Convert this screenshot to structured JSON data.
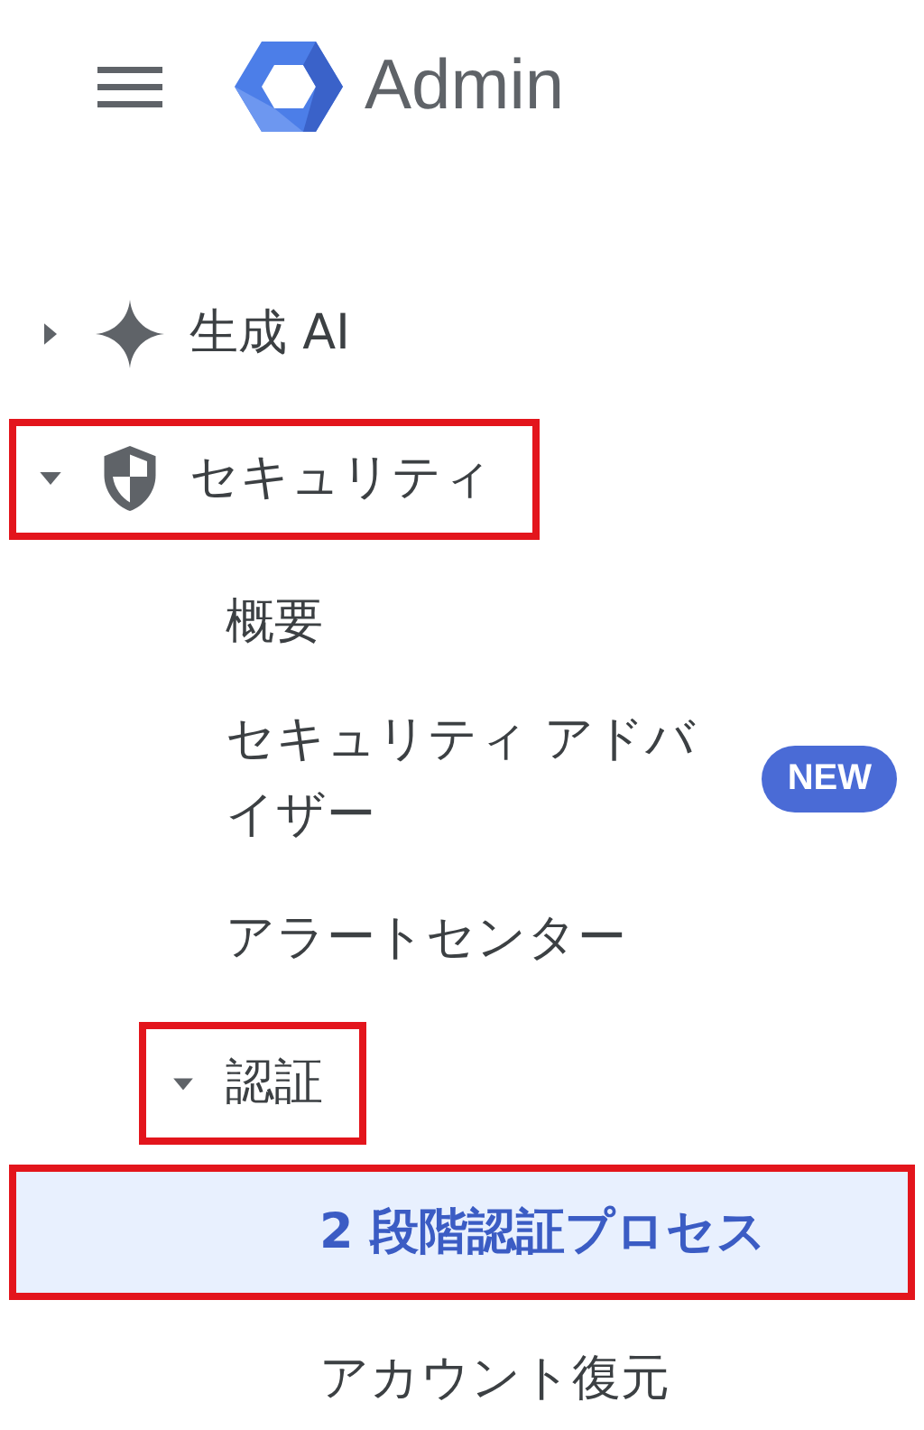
{
  "header": {
    "title": "Admin"
  },
  "nav": [
    {
      "label": "生成 AI",
      "kind": "sparkle",
      "expanded": false,
      "annotated": false
    },
    {
      "label": "セキュリティ",
      "kind": "shield",
      "expanded": true,
      "annotated": true,
      "children": [
        {
          "label": "概要",
          "selected": false
        },
        {
          "label": "セキュリティ アドバイザー",
          "badge": "NEW",
          "selected": false
        },
        {
          "label": "アラートセンター",
          "selected": false
        },
        {
          "label": "認証",
          "expanded": true,
          "annotated": true,
          "children": [
            {
              "label": "2 段階認証プロセス",
              "selected": true,
              "annotated": true
            },
            {
              "label": "アカウント復元",
              "selected": false,
              "annotated": false
            }
          ]
        }
      ]
    }
  ]
}
